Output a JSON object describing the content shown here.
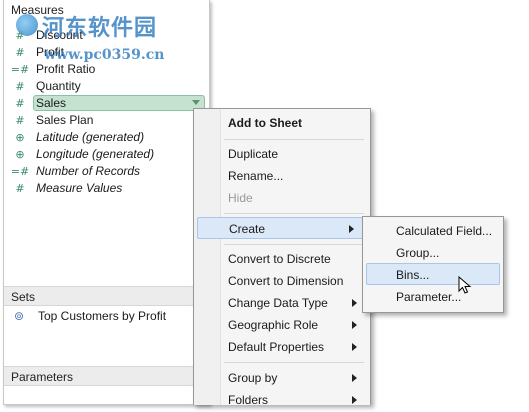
{
  "watermark": {
    "text": "河东软件园",
    "url": "www.pc0359.cn"
  },
  "data_pane": {
    "measures_header": "Measures",
    "fields": [
      {
        "label": "Discount",
        "icon": "hash-icon",
        "italic": false
      },
      {
        "label": "Profit",
        "icon": "hash-icon",
        "italic": false
      },
      {
        "label": "Profit Ratio",
        "icon": "calculated-hash-icon",
        "italic": false
      },
      {
        "label": "Quantity",
        "icon": "hash-icon",
        "italic": false
      },
      {
        "label": "Sales",
        "icon": "hash-icon",
        "italic": false
      },
      {
        "label": "Sales Plan",
        "icon": "calculated-hash-icon",
        "italic": false
      },
      {
        "label": "Latitude (generated)",
        "icon": "globe-icon",
        "italic": true
      },
      {
        "label": "Longitude (generated)",
        "icon": "globe-icon",
        "italic": true
      },
      {
        "label": "Number of Records",
        "icon": "calculated-hash-icon",
        "italic": true
      },
      {
        "label": "Measure Values",
        "icon": "hash-icon",
        "italic": true
      }
    ],
    "sets_header": "Sets",
    "sets": [
      {
        "label": "Top Customers by Profit",
        "icon": "set-icon"
      }
    ],
    "parameters_header": "Parameters"
  },
  "context_menu": {
    "items": [
      {
        "label": "Add to Sheet",
        "bold": true
      },
      {
        "label": "Duplicate"
      },
      {
        "label": "Rename..."
      },
      {
        "label": "Hide",
        "disabled": true
      },
      {
        "label": "Create",
        "submenu": true,
        "highlighted": true
      },
      {
        "label": "Convert to Discrete"
      },
      {
        "label": "Convert to Dimension"
      },
      {
        "label": "Change Data Type",
        "submenu": true
      },
      {
        "label": "Geographic Role",
        "submenu": true
      },
      {
        "label": "Default Properties",
        "submenu": true
      },
      {
        "label": "Group by",
        "submenu": true
      },
      {
        "label": "Folders",
        "submenu": true
      }
    ]
  },
  "create_submenu": {
    "items": [
      {
        "label": "Calculated Field..."
      },
      {
        "label": "Group..."
      },
      {
        "label": "Bins...",
        "highlighted": true
      },
      {
        "label": "Parameter..."
      }
    ]
  },
  "colors": {
    "selection_fill": "#c4e2cf",
    "menu_highlight": "#dbe8f7",
    "field_icon": "#3b8a66"
  }
}
